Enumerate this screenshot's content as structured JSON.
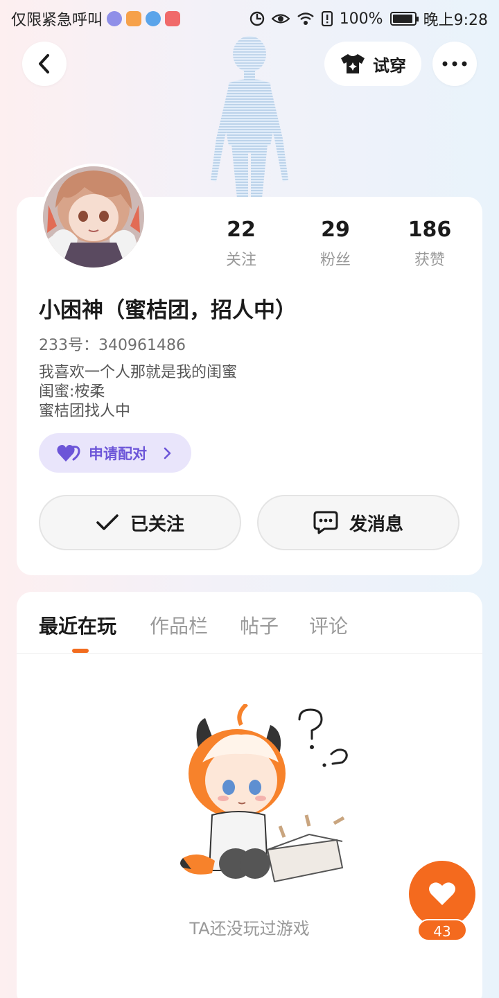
{
  "status_bar": {
    "carrier": "仅限紧急呼叫",
    "battery": "100%",
    "time": "晚上9:28"
  },
  "header": {
    "back_icon": "chevron-left-icon",
    "tryon_label": "试穿",
    "tryon_icon": "tshirt-icon",
    "more_icon": "more-dots-icon"
  },
  "profile": {
    "stats": [
      {
        "value": "22",
        "label": "关注"
      },
      {
        "value": "29",
        "label": "粉丝"
      },
      {
        "value": "186",
        "label": "获赞"
      }
    ],
    "nickname": "小困神（蜜桔团，招人中）",
    "uid_label": "233号：",
    "uid_value": "340961486",
    "bio_lines": [
      "我喜欢一个人那就是我的闺蜜",
      "闺蜜:桉柔",
      "蜜桔团找人中"
    ],
    "pair_label": "申请配对",
    "follow_label": "已关注",
    "message_label": "发消息"
  },
  "tabs": [
    "最近在玩",
    "作品栏",
    "帖子",
    "评论"
  ],
  "active_tab": 0,
  "empty_text": "TA还没玩过游戏",
  "like_count": "43",
  "colors": {
    "accent": "#f46a1e",
    "pair": "#6c55d8"
  }
}
